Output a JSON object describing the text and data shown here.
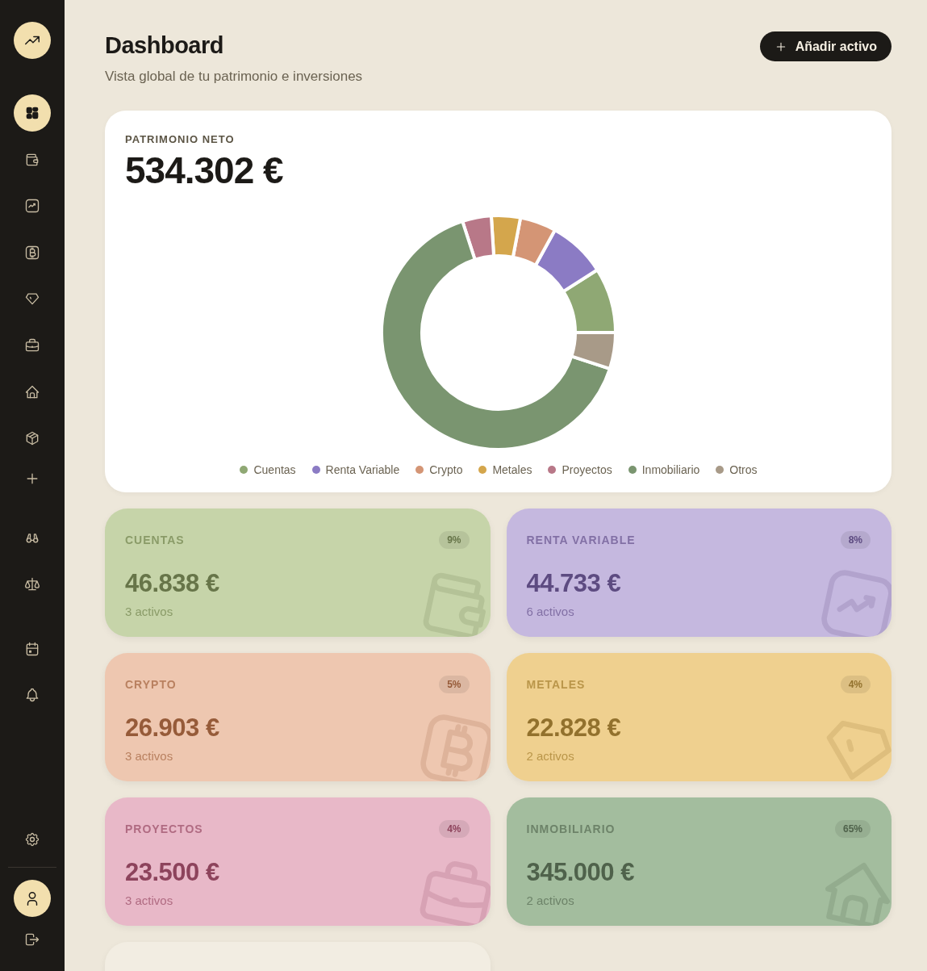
{
  "sidebar": {
    "items": [
      {
        "selected": true
      },
      {
        "selected": false
      },
      {
        "selected": false
      },
      {
        "selected": false
      },
      {
        "selected": false
      },
      {
        "selected": false
      },
      {
        "selected": false
      },
      {
        "selected": false
      },
      {
        "selected": false
      },
      {
        "selected": false
      },
      {
        "selected": false
      },
      {
        "selected": false
      },
      {
        "selected": false
      }
    ]
  },
  "header": {
    "title": "Dashboard",
    "subtitle": "Vista global de tu patrimonio e inversiones",
    "button": "Añadir activo"
  },
  "net_worth": {
    "label": "PATRIMONIO NETO",
    "value": "534.302 €",
    "chart_data": {
      "type": "donut",
      "categories": [
        "Cuentas",
        "Renta Variable",
        "Crypto",
        "Metales",
        "Proyectos",
        "Inmobiliario",
        "Otros"
      ],
      "values": [
        9,
        8,
        5,
        4,
        4,
        65,
        5
      ]
    },
    "legend": [
      {
        "color": "#8fa874"
      },
      {
        "color": "#8b7bc4"
      },
      {
        "color": "#d49575"
      },
      {
        "color": "#d4a64c"
      },
      {
        "color": "#b87888"
      },
      {
        "color": "#7a9570"
      },
      {
        "color": "#a89a88"
      }
    ]
  },
  "categories": [
    {
      "title": "CUENTAS",
      "percent": "9%",
      "value": "46.838 €",
      "count": "3 activos",
      "color": "#c6d4a9"
    },
    {
      "title": "RENTA VARIABLE",
      "percent": "8%",
      "value": "44.733 €",
      "count": "6 activos",
      "color": "#c5b8df"
    },
    {
      "title": "CRYPTO",
      "percent": "5%",
      "value": "26.903 €",
      "count": "3 activos",
      "color": "#eec7b0"
    },
    {
      "title": "METALES",
      "percent": "4%",
      "value": "22.828 €",
      "count": "2 activos",
      "color": "#efd08f"
    },
    {
      "title": "PROYECTOS",
      "percent": "4%",
      "value": "23.500 €",
      "count": "3 activos",
      "color": "#e8b8c8"
    },
    {
      "title": "INMOBILIARIO",
      "percent": "65%",
      "value": "345.000 €",
      "count": "2 activos",
      "color": "#a3bd9e"
    },
    {
      "color": "#f2ede2"
    }
  ]
}
